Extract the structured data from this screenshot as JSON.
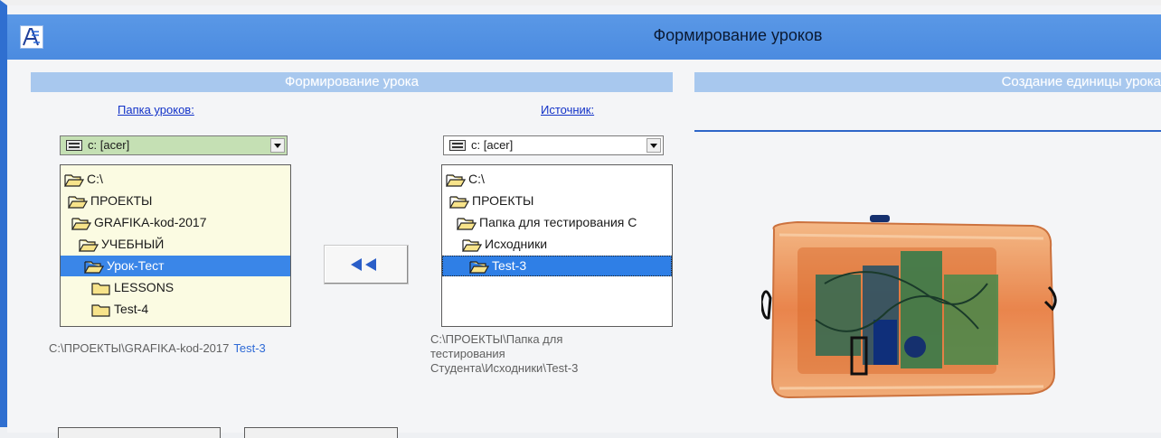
{
  "window": {
    "title": "Формирование уроков",
    "accent": "#4b8be0"
  },
  "left_panel": {
    "header": "Формирование урока",
    "lessons_folder": {
      "label": "Папка уроков:",
      "drive": "c: [acer]",
      "tree": [
        {
          "label": "C:\\",
          "icon": "folder-open-icon",
          "selected": false
        },
        {
          "label": "ПРОЕКТЫ",
          "icon": "folder-open-icon",
          "selected": false
        },
        {
          "label": "GRAFIKA-kod-2017",
          "icon": "folder-open-icon",
          "selected": false
        },
        {
          "label": "УЧЕБНЫЙ",
          "icon": "folder-open-icon",
          "selected": false
        },
        {
          "label": "Урок-Тест",
          "icon": "folder-open-icon",
          "selected": true
        },
        {
          "label": "LESSONS",
          "icon": "folder-closed-icon",
          "selected": false
        },
        {
          "label": "Test-4",
          "icon": "folder-closed-icon",
          "selected": false
        }
      ],
      "path": "C:\\ПРОЕКТЫ\\GRAFIKA-kod-2017",
      "path_highlight": "Test-3"
    },
    "source": {
      "label": "Источник:",
      "drive": "c: [acer]",
      "tree": [
        {
          "label": "C:\\",
          "icon": "folder-open-icon",
          "selected": false
        },
        {
          "label": "ПРОЕКТЫ",
          "icon": "folder-open-icon",
          "selected": false
        },
        {
          "label": "Папка для тестирования С",
          "icon": "folder-open-icon",
          "selected": false
        },
        {
          "label": "Исходники",
          "icon": "folder-open-icon",
          "selected": false
        },
        {
          "label": "Test-3",
          "icon": "folder-open-icon",
          "selected": true
        }
      ],
      "path_lines": [
        "C:\\ПРОЕКТЫ\\Папка для",
        "тестирования",
        "Студента\\Исходники\\Test-3"
      ]
    },
    "move_button_icon": "double-left-arrow-icon"
  },
  "right_panel": {
    "header": "Создание единицы урока"
  }
}
